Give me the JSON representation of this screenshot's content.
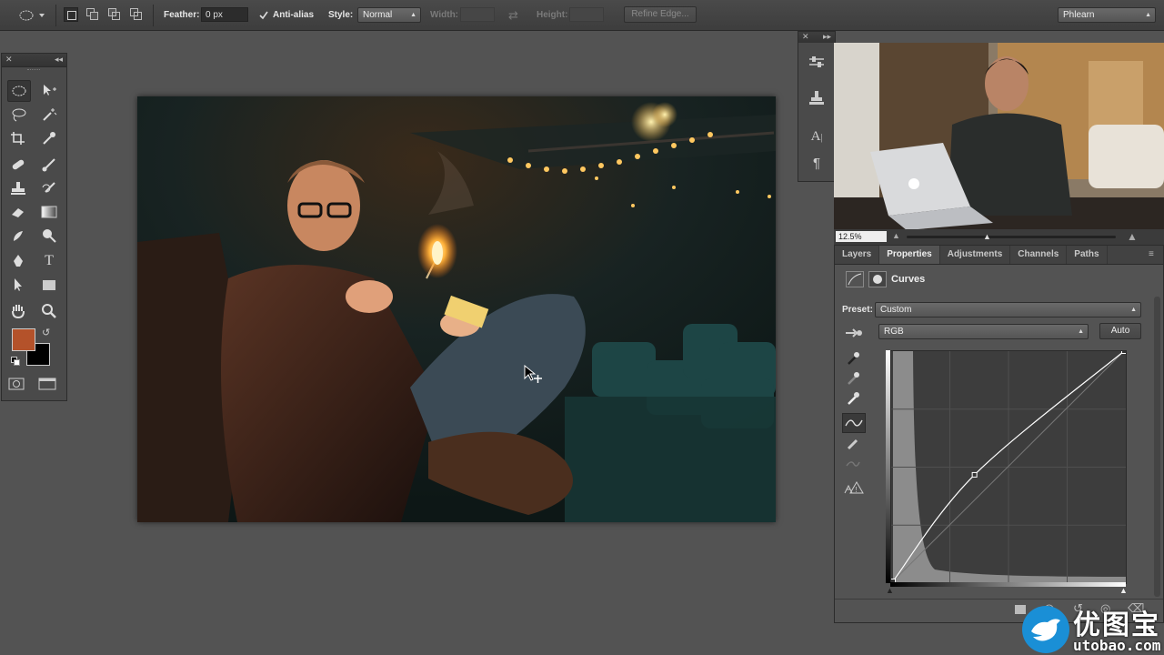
{
  "options_bar": {
    "feather_label": "Feather:",
    "feather_value": "0 px",
    "antialias_label": "Anti-alias",
    "antialias_checked": true,
    "style_label": "Style:",
    "style_value": "Normal",
    "width_label": "Width:",
    "height_label": "Height:",
    "refine_edge_label": "Refine Edge...",
    "workspace_value": "Phlearn"
  },
  "toolbox": {
    "foreground_color": "#b4522a",
    "background_color": "#000000",
    "tools": [
      "elliptical-marquee",
      "move",
      "lasso",
      "magic-wand",
      "crop",
      "eyedropper",
      "healing-brush",
      "brush",
      "clone-stamp",
      "history-brush",
      "eraser",
      "gradient",
      "blur",
      "dodge",
      "pen",
      "type",
      "path-selection",
      "rectangle",
      "hand",
      "zoom",
      "quick-mask",
      "screen-mode"
    ],
    "type_glyph": "T"
  },
  "navigator": {
    "zoom": "12.5%"
  },
  "panel_tabs": {
    "layers": "Layers",
    "properties": "Properties",
    "adjustments": "Adjustments",
    "channels": "Channels",
    "paths": "Paths"
  },
  "properties": {
    "title": "Curves",
    "preset_label": "Preset:",
    "preset_value": "Custom",
    "channel_value": "RGB",
    "auto_label": "Auto"
  },
  "curve": {
    "points": [
      [
        0,
        0
      ],
      [
        90,
        118
      ],
      [
        255,
        255
      ]
    ]
  },
  "watermark": {
    "chinese": "优图宝",
    "url": "utobao.com"
  },
  "colors": {
    "accent": "#1a8fd6"
  }
}
